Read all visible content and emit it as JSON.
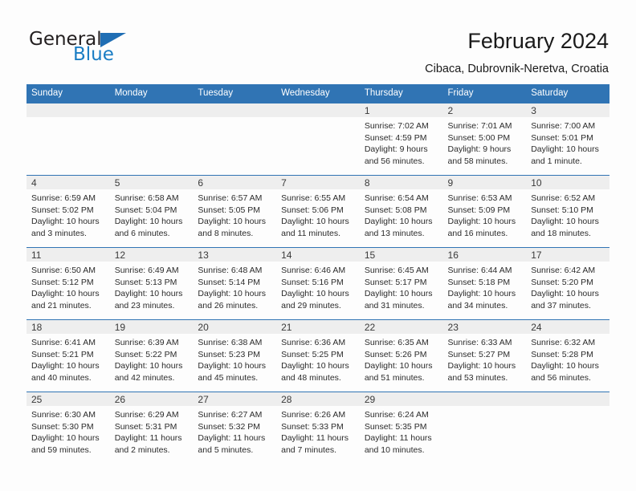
{
  "brand": {
    "name_part1": "General",
    "name_part2": "Blue",
    "flag_icon": "triangle-flag-icon",
    "accent_color": "#1f6eb4"
  },
  "header": {
    "title": "February 2024",
    "location": "Cibaca, Dubrovnik-Neretva, Croatia"
  },
  "theme": {
    "header_blue": "#3074b4",
    "daynum_band": "#eeeeee",
    "page_background": "#fdfdfd"
  },
  "calendar": {
    "weekday_headers": [
      "Sunday",
      "Monday",
      "Tuesday",
      "Wednesday",
      "Thursday",
      "Friday",
      "Saturday"
    ],
    "weeks": [
      [
        {
          "day": "",
          "lines": []
        },
        {
          "day": "",
          "lines": []
        },
        {
          "day": "",
          "lines": []
        },
        {
          "day": "",
          "lines": []
        },
        {
          "day": "1",
          "lines": [
            "Sunrise: 7:02 AM",
            "Sunset: 4:59 PM",
            "Daylight: 9 hours",
            "and 56 minutes."
          ]
        },
        {
          "day": "2",
          "lines": [
            "Sunrise: 7:01 AM",
            "Sunset: 5:00 PM",
            "Daylight: 9 hours",
            "and 58 minutes."
          ]
        },
        {
          "day": "3",
          "lines": [
            "Sunrise: 7:00 AM",
            "Sunset: 5:01 PM",
            "Daylight: 10 hours",
            "and 1 minute."
          ]
        }
      ],
      [
        {
          "day": "4",
          "lines": [
            "Sunrise: 6:59 AM",
            "Sunset: 5:02 PM",
            "Daylight: 10 hours",
            "and 3 minutes."
          ]
        },
        {
          "day": "5",
          "lines": [
            "Sunrise: 6:58 AM",
            "Sunset: 5:04 PM",
            "Daylight: 10 hours",
            "and 6 minutes."
          ]
        },
        {
          "day": "6",
          "lines": [
            "Sunrise: 6:57 AM",
            "Sunset: 5:05 PM",
            "Daylight: 10 hours",
            "and 8 minutes."
          ]
        },
        {
          "day": "7",
          "lines": [
            "Sunrise: 6:55 AM",
            "Sunset: 5:06 PM",
            "Daylight: 10 hours",
            "and 11 minutes."
          ]
        },
        {
          "day": "8",
          "lines": [
            "Sunrise: 6:54 AM",
            "Sunset: 5:08 PM",
            "Daylight: 10 hours",
            "and 13 minutes."
          ]
        },
        {
          "day": "9",
          "lines": [
            "Sunrise: 6:53 AM",
            "Sunset: 5:09 PM",
            "Daylight: 10 hours",
            "and 16 minutes."
          ]
        },
        {
          "day": "10",
          "lines": [
            "Sunrise: 6:52 AM",
            "Sunset: 5:10 PM",
            "Daylight: 10 hours",
            "and 18 minutes."
          ]
        }
      ],
      [
        {
          "day": "11",
          "lines": [
            "Sunrise: 6:50 AM",
            "Sunset: 5:12 PM",
            "Daylight: 10 hours",
            "and 21 minutes."
          ]
        },
        {
          "day": "12",
          "lines": [
            "Sunrise: 6:49 AM",
            "Sunset: 5:13 PM",
            "Daylight: 10 hours",
            "and 23 minutes."
          ]
        },
        {
          "day": "13",
          "lines": [
            "Sunrise: 6:48 AM",
            "Sunset: 5:14 PM",
            "Daylight: 10 hours",
            "and 26 minutes."
          ]
        },
        {
          "day": "14",
          "lines": [
            "Sunrise: 6:46 AM",
            "Sunset: 5:16 PM",
            "Daylight: 10 hours",
            "and 29 minutes."
          ]
        },
        {
          "day": "15",
          "lines": [
            "Sunrise: 6:45 AM",
            "Sunset: 5:17 PM",
            "Daylight: 10 hours",
            "and 31 minutes."
          ]
        },
        {
          "day": "16",
          "lines": [
            "Sunrise: 6:44 AM",
            "Sunset: 5:18 PM",
            "Daylight: 10 hours",
            "and 34 minutes."
          ]
        },
        {
          "day": "17",
          "lines": [
            "Sunrise: 6:42 AM",
            "Sunset: 5:20 PM",
            "Daylight: 10 hours",
            "and 37 minutes."
          ]
        }
      ],
      [
        {
          "day": "18",
          "lines": [
            "Sunrise: 6:41 AM",
            "Sunset: 5:21 PM",
            "Daylight: 10 hours",
            "and 40 minutes."
          ]
        },
        {
          "day": "19",
          "lines": [
            "Sunrise: 6:39 AM",
            "Sunset: 5:22 PM",
            "Daylight: 10 hours",
            "and 42 minutes."
          ]
        },
        {
          "day": "20",
          "lines": [
            "Sunrise: 6:38 AM",
            "Sunset: 5:23 PM",
            "Daylight: 10 hours",
            "and 45 minutes."
          ]
        },
        {
          "day": "21",
          "lines": [
            "Sunrise: 6:36 AM",
            "Sunset: 5:25 PM",
            "Daylight: 10 hours",
            "and 48 minutes."
          ]
        },
        {
          "day": "22",
          "lines": [
            "Sunrise: 6:35 AM",
            "Sunset: 5:26 PM",
            "Daylight: 10 hours",
            "and 51 minutes."
          ]
        },
        {
          "day": "23",
          "lines": [
            "Sunrise: 6:33 AM",
            "Sunset: 5:27 PM",
            "Daylight: 10 hours",
            "and 53 minutes."
          ]
        },
        {
          "day": "24",
          "lines": [
            "Sunrise: 6:32 AM",
            "Sunset: 5:28 PM",
            "Daylight: 10 hours",
            "and 56 minutes."
          ]
        }
      ],
      [
        {
          "day": "25",
          "lines": [
            "Sunrise: 6:30 AM",
            "Sunset: 5:30 PM",
            "Daylight: 10 hours",
            "and 59 minutes."
          ]
        },
        {
          "day": "26",
          "lines": [
            "Sunrise: 6:29 AM",
            "Sunset: 5:31 PM",
            "Daylight: 11 hours",
            "and 2 minutes."
          ]
        },
        {
          "day": "27",
          "lines": [
            "Sunrise: 6:27 AM",
            "Sunset: 5:32 PM",
            "Daylight: 11 hours",
            "and 5 minutes."
          ]
        },
        {
          "day": "28",
          "lines": [
            "Sunrise: 6:26 AM",
            "Sunset: 5:33 PM",
            "Daylight: 11 hours",
            "and 7 minutes."
          ]
        },
        {
          "day": "29",
          "lines": [
            "Sunrise: 6:24 AM",
            "Sunset: 5:35 PM",
            "Daylight: 11 hours",
            "and 10 minutes."
          ]
        },
        {
          "day": "",
          "lines": []
        },
        {
          "day": "",
          "lines": []
        }
      ]
    ]
  }
}
